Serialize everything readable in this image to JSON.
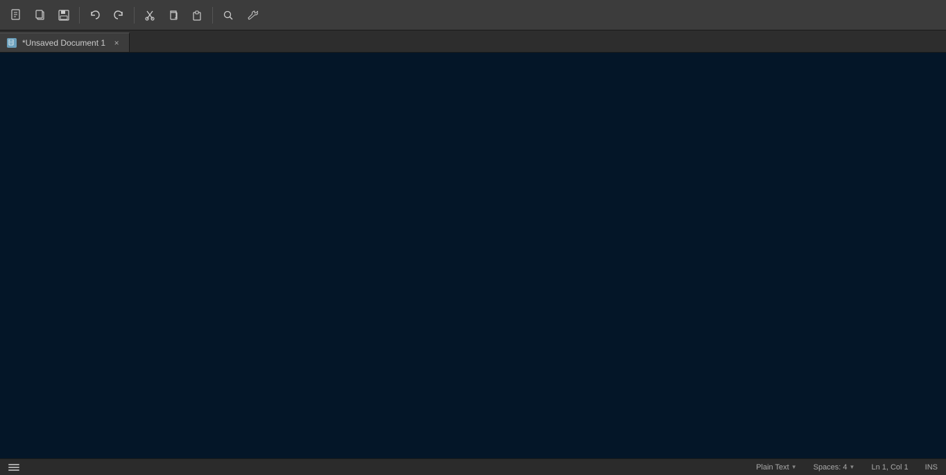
{
  "toolbar": {
    "buttons": [
      {
        "name": "new-file",
        "icon": "⬜",
        "label": "New File"
      },
      {
        "name": "copy-file",
        "icon": "❐",
        "label": "Copy"
      },
      {
        "name": "save",
        "icon": "💾",
        "label": "Save"
      }
    ],
    "undo_label": "Undo",
    "redo_label": "Redo",
    "cut_label": "Cut",
    "copy_label": "Copy",
    "paste_label": "Paste",
    "find_label": "Find",
    "tools_label": "Tools"
  },
  "tab": {
    "title": "*Unsaved Document 1",
    "close_label": "×"
  },
  "statusbar": {
    "sidebar_toggle": "☰",
    "language": "Plain Text",
    "spaces": "Spaces: 4",
    "position": "Ln 1, Col 1",
    "ins": "INS"
  }
}
